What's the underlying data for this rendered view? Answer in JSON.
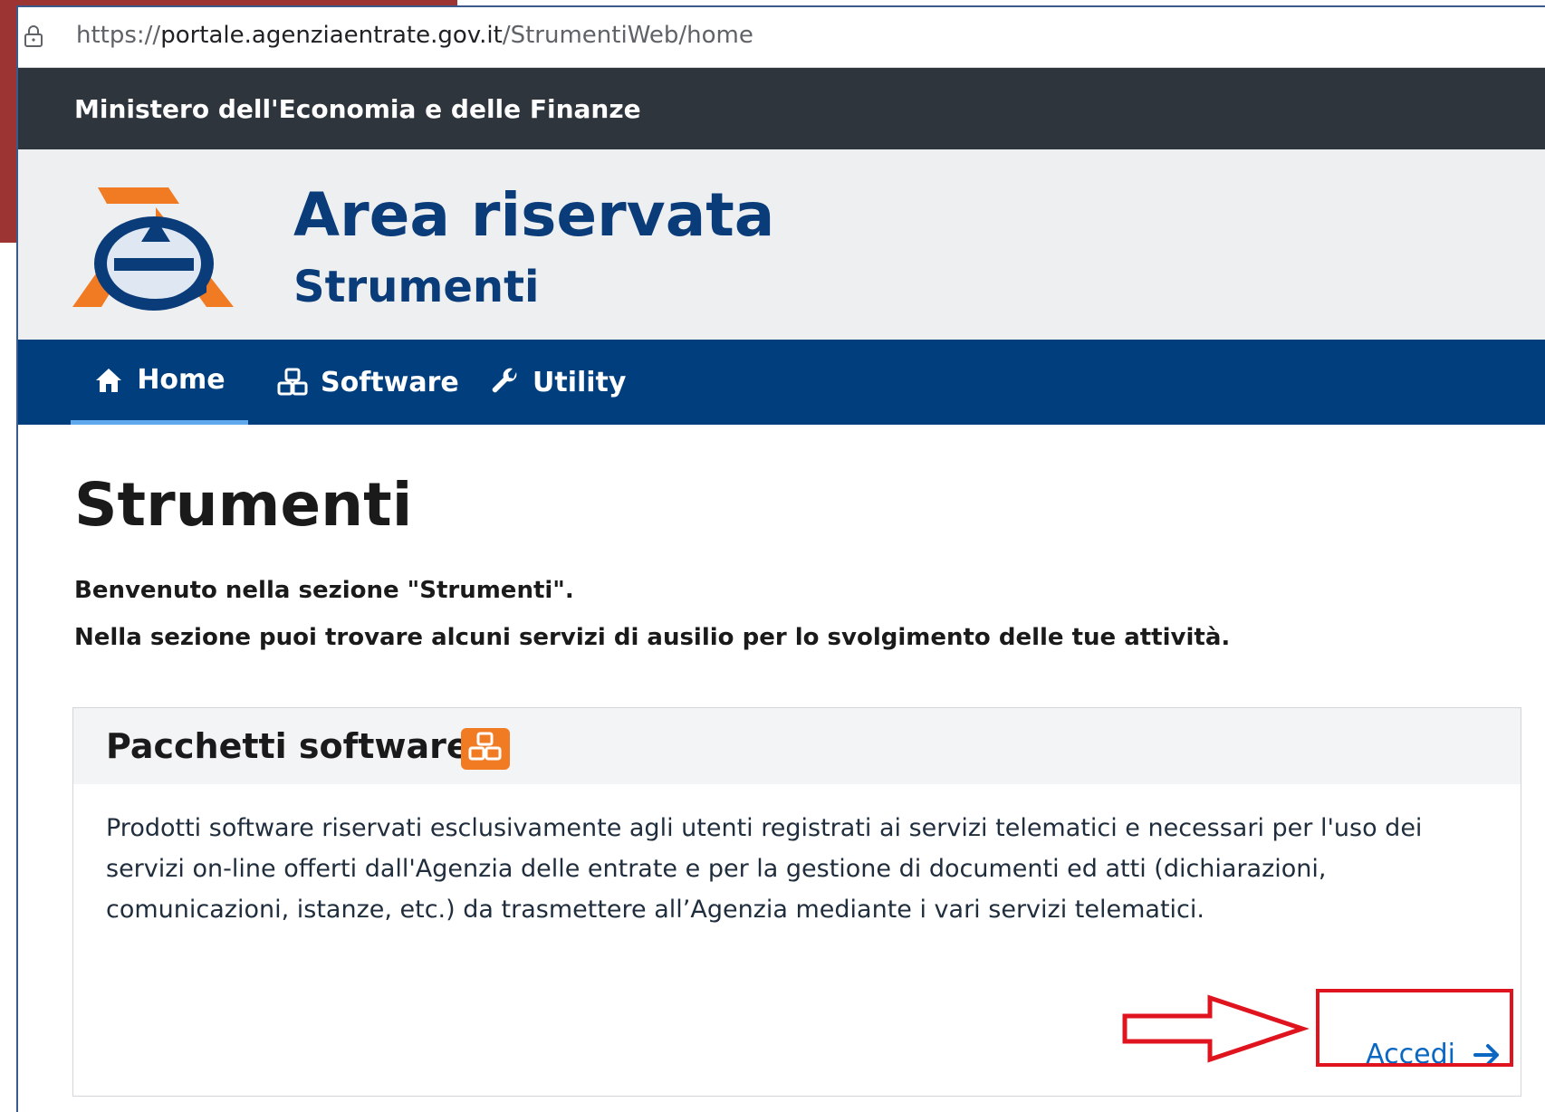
{
  "browser": {
    "url_prefix": "https://",
    "url_host": "portale.agenziaentrate.gov.it",
    "url_path": "/StrumentiWeb/home"
  },
  "ministry": {
    "label": "Ministero dell'Economia e delle Finanze"
  },
  "banner": {
    "title": "Area riservata",
    "subtitle": "Strumenti",
    "logo_icon": "agenzia-entrate-logo"
  },
  "nav": {
    "items": [
      {
        "label": "Home",
        "icon": "home-icon",
        "active": true
      },
      {
        "label": "Software",
        "icon": "cubes-icon",
        "active": false
      },
      {
        "label": "Utility",
        "icon": "wrench-icon",
        "active": false
      }
    ]
  },
  "page": {
    "title": "Strumenti",
    "welcome": "Benvenuto nella sezione \"Strumenti\".",
    "intro": "Nella sezione puoi trovare alcuni servizi di ausilio per lo svolgimento delle tue attività."
  },
  "card": {
    "title": "Pacchetti software",
    "icon": "cubes-icon",
    "body": "Prodotti software riservati esclusivamente agli utenti registrati ai servizi telematici e necessari per l'uso dei servizi on-line offerti dall'Agenzia delle entrate e per la gestione di documenti ed atti (dichiarazioni, comunicazioni, istanze, etc.) da trasmettere all’Agenzia mediante i vari servizi telematici.",
    "action_label": "Accedi"
  },
  "colors": {
    "nav_bg": "#003e7e",
    "ministry_bg": "#2f353c",
    "title_blue": "#0b3c7a",
    "accent_orange": "#f07b22",
    "highlight_red": "#e0141e",
    "link_blue": "#0a67c2"
  }
}
